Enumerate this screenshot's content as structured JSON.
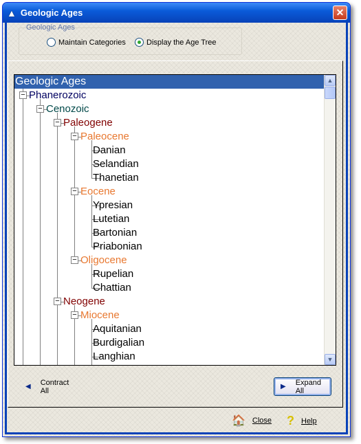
{
  "window": {
    "title": "Geologic Ages",
    "close_glyph": "✕",
    "icon": "triangle-icon"
  },
  "group": {
    "label": "Geologic Ages",
    "options": [
      {
        "label": "Maintain Categories",
        "selected": false
      },
      {
        "label": "Display the Age Tree",
        "selected": true
      }
    ]
  },
  "tree": {
    "nodes": [
      {
        "label": "Geologic Ages",
        "level": 0,
        "selected": true
      },
      {
        "label": "Phanerozoic",
        "level": 1,
        "expanded": true,
        "color": "#000060"
      },
      {
        "label": "Cenozoic",
        "level": 2,
        "expanded": true,
        "color": "#004848"
      },
      {
        "label": "Paleogene",
        "level": 3,
        "expanded": true,
        "color": "#800000"
      },
      {
        "label": "Paleocene",
        "level": 4,
        "expanded": true,
        "color": "#e87830"
      },
      {
        "label": "Danian",
        "level": 5
      },
      {
        "label": "Selandian",
        "level": 5
      },
      {
        "label": "Thanetian",
        "level": 5
      },
      {
        "label": "Eocene",
        "level": 4,
        "expanded": true,
        "color": "#e87830"
      },
      {
        "label": "Ypresian",
        "level": 5
      },
      {
        "label": "Lutetian",
        "level": 5
      },
      {
        "label": "Bartonian",
        "level": 5
      },
      {
        "label": "Priabonian",
        "level": 5
      },
      {
        "label": "Oligocene",
        "level": 4,
        "expanded": true,
        "color": "#e87830"
      },
      {
        "label": "Rupelian",
        "level": 5
      },
      {
        "label": "Chattian",
        "level": 5
      },
      {
        "label": "Neogene",
        "level": 3,
        "expanded": true,
        "color": "#800000"
      },
      {
        "label": "Miocene",
        "level": 4,
        "expanded": true,
        "color": "#e87830"
      },
      {
        "label": "Aquitanian",
        "level": 5
      },
      {
        "label": "Burdigalian",
        "level": 5
      },
      {
        "label": "Langhian",
        "level": 5
      }
    ]
  },
  "buttons": {
    "contract": {
      "line1": "Contract",
      "line2": "All"
    },
    "expand": {
      "line1": "Expand",
      "line2": "All"
    },
    "close": "Close",
    "help": "Help"
  }
}
